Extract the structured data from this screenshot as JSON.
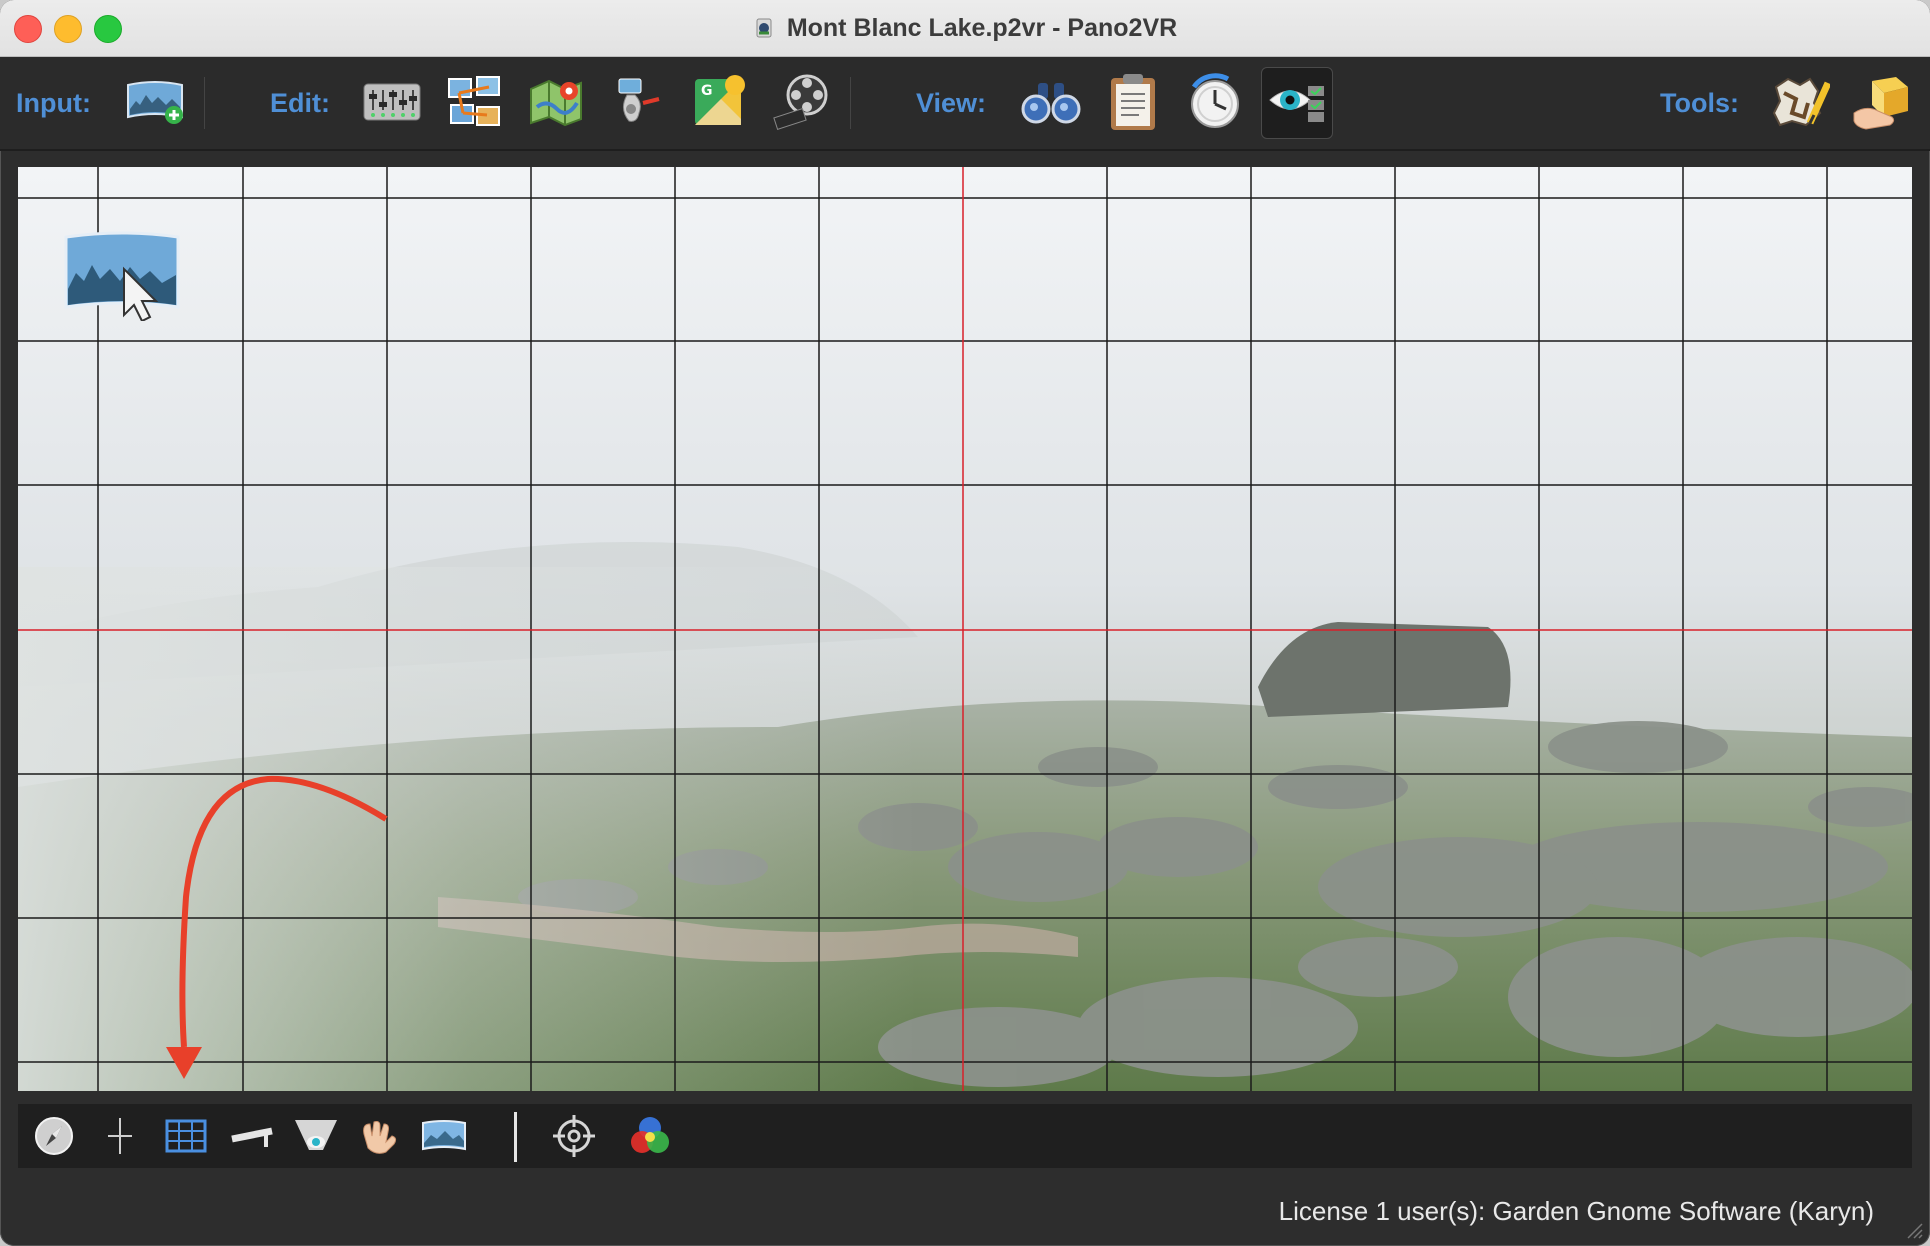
{
  "window": {
    "title": "Mont Blanc Lake.p2vr - Pano2VR"
  },
  "toolbar": {
    "input_label": "Input:",
    "edit_label": "Edit:",
    "view_label": "View:",
    "tools_label": "Tools:",
    "input_buttons": [
      "import-panorama-icon"
    ],
    "edit_buttons": [
      "properties-icon",
      "patch-icon",
      "tour-map-icon",
      "audio-icon",
      "google-street-view-icon",
      "animation-icon"
    ],
    "view_buttons": [
      "viewer-binoculars-icon",
      "clipboard-notes-icon",
      "user-data-icon",
      "viewing-parameters-icon"
    ],
    "tools_buttons": [
      "localization-map-icon",
      "transform-hand-icon"
    ],
    "active_view_button": "viewing-parameters-icon"
  },
  "viewport": {
    "overlay_icon": "panorama-cursor-icon",
    "grid": "on",
    "horizon_line_color": "#d8202a",
    "annotation_arrow_color": "#e8402a"
  },
  "bottom_tools": {
    "buttons": [
      "compass-icon",
      "crosshair-plus-icon",
      "grid-icon",
      "level-icon",
      "field-of-view-icon",
      "hand-icon",
      "panorama-frame-icon"
    ],
    "extra_buttons": [
      "target-icon",
      "color-channels-icon"
    ],
    "active_button": "grid-icon"
  },
  "status": {
    "license_text": "License 1 user(s): Garden Gnome Software (Karyn)"
  }
}
